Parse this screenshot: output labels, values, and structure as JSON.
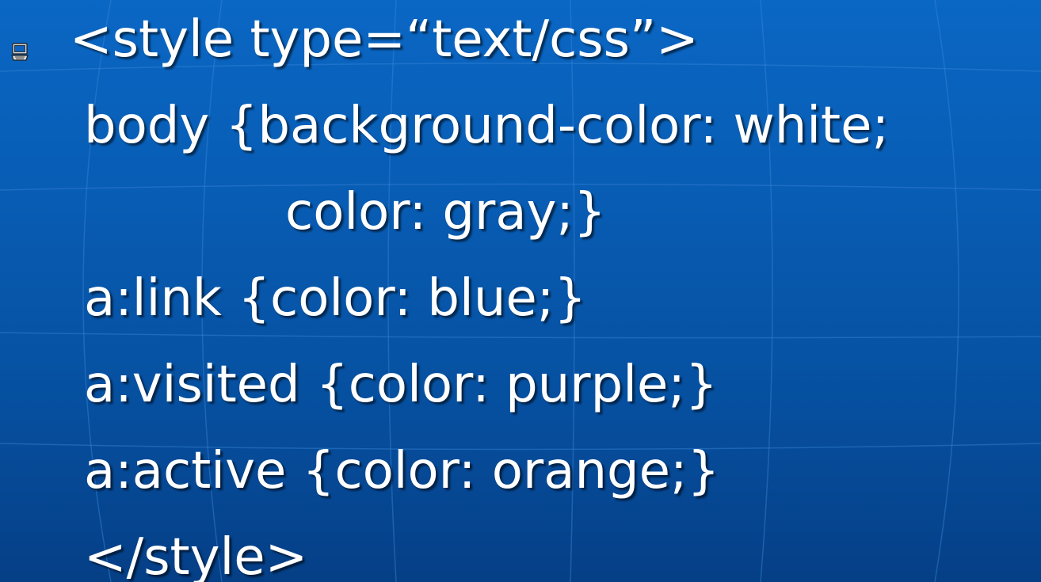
{
  "slide": {
    "lines": [
      "<style type=“text/css”>",
      "body {background-color: white;",
      "color: gray;}",
      "a:link {color: blue;}",
      "a:visited {color: purple;}",
      "a:active {color: orange;}",
      "</style>"
    ],
    "bullet_icon": "computer-icon",
    "background_color": "#085cb3",
    "text_color": "#ffffff"
  }
}
